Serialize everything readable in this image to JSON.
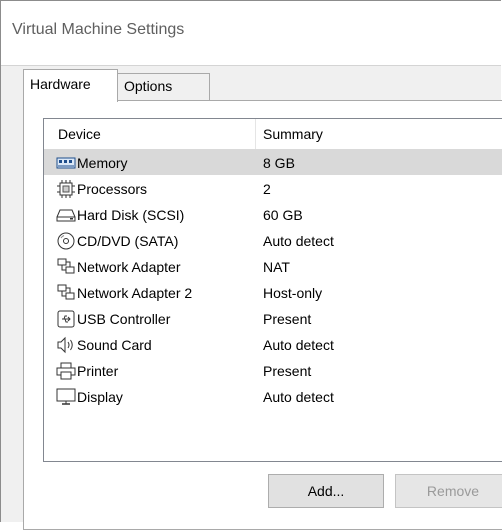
{
  "window": {
    "title": "Virtual Machine Settings"
  },
  "tabs": [
    {
      "label": "Hardware"
    },
    {
      "label": "Options"
    }
  ],
  "device_list": {
    "columns": {
      "device": "Device",
      "summary": "Summary"
    },
    "rows": [
      {
        "device": "Memory",
        "summary": "8 GB",
        "icon": "memory-icon"
      },
      {
        "device": "Processors",
        "summary": "2",
        "icon": "processor-icon"
      },
      {
        "device": "Hard Disk (SCSI)",
        "summary": "60 GB",
        "icon": "hard-disk-icon"
      },
      {
        "device": "CD/DVD (SATA)",
        "summary": "Auto detect",
        "icon": "cd-dvd-icon"
      },
      {
        "device": "Network Adapter",
        "summary": "NAT",
        "icon": "network-icon"
      },
      {
        "device": "Network Adapter 2",
        "summary": "Host-only",
        "icon": "network-icon"
      },
      {
        "device": "USB Controller",
        "summary": "Present",
        "icon": "usb-icon"
      },
      {
        "device": "Sound Card",
        "summary": "Auto detect",
        "icon": "speaker-icon"
      },
      {
        "device": "Printer",
        "summary": "Present",
        "icon": "printer-icon"
      },
      {
        "device": "Display",
        "summary": "Auto detect",
        "icon": "monitor-icon"
      }
    ]
  },
  "buttons": {
    "add": "Add...",
    "remove": "Remove"
  }
}
